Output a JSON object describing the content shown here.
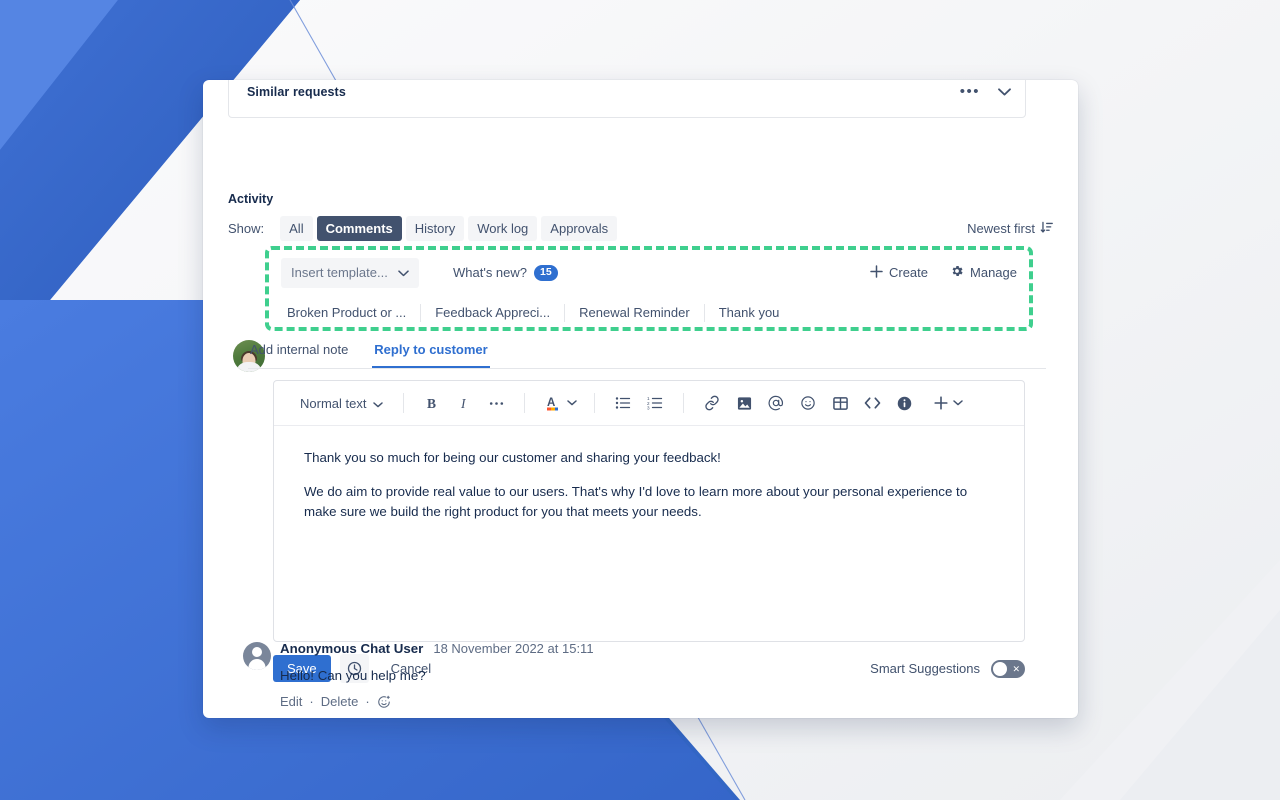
{
  "background": {
    "base_color": "#f5f6f8",
    "blue_primary": "#3c6fd6",
    "blue_dark": "#2f64c4",
    "blue_deep": "#2a5fb8"
  },
  "similar_requests": {
    "title": "Similar requests",
    "more_icon": "more-horizontal-icon",
    "collapse_icon": "chevron-down-icon"
  },
  "activity": {
    "title": "Activity",
    "show_label": "Show:",
    "filters": [
      {
        "label": "All",
        "active": false
      },
      {
        "label": "Comments",
        "active": true
      },
      {
        "label": "History",
        "active": false
      },
      {
        "label": "Work log",
        "active": false
      },
      {
        "label": "Approvals",
        "active": false
      }
    ],
    "sort": {
      "label": "Newest first",
      "icon": "sort-descending-icon"
    }
  },
  "templates": {
    "select_placeholder": "Insert template...",
    "select_chevron": "chevron-down-icon",
    "whats_new": {
      "label": "What's new?",
      "count": "15"
    },
    "create": {
      "label": "Create",
      "icon": "plus-icon"
    },
    "manage": {
      "label": "Manage",
      "icon": "gear-icon"
    },
    "chips": [
      "Broken Product or ...",
      "Feedback Appreci...",
      "Renewal Reminder",
      "Thank you"
    ],
    "highlight_color": "#3fcf8e"
  },
  "editor": {
    "tabs": [
      {
        "label": "Add internal note",
        "active": false
      },
      {
        "label": "Reply to customer",
        "active": true
      }
    ],
    "toolbar": {
      "style_select": "Normal text",
      "style_chevron": "chevron-down-icon",
      "buttons": [
        "bold-icon",
        "italic-icon",
        "more-formatting-icon",
        "text-color-icon",
        "text-color-chevron-icon",
        "bullet-list-icon",
        "numbered-list-icon",
        "link-icon",
        "image-icon",
        "mention-icon",
        "emoji-icon",
        "table-icon",
        "code-icon",
        "info-panel-icon",
        "insert-more-icon",
        "insert-more-chevron-icon"
      ]
    },
    "body_paragraphs": [
      "Thank you so much for being our customer and sharing your feedback!",
      "We do aim to provide real value to our users. That's why I'd love to learn more about your personal experience to make sure we build the right product for you that meets your needs."
    ]
  },
  "actions": {
    "save_label": "Save",
    "timer_icon": "clock-icon",
    "cancel_label": "Cancel",
    "smart_suggestions_label": "Smart Suggestions",
    "smart_suggestions_state": "off"
  },
  "comment": {
    "author": "Anonymous Chat User",
    "timestamp": "18 November 2022 at 15:11",
    "text": "Hello! Can you help me?",
    "edit_label": "Edit",
    "separator": "·",
    "delete_label": "Delete",
    "separator2": "·",
    "emoji_icon": "add-reaction-icon"
  }
}
